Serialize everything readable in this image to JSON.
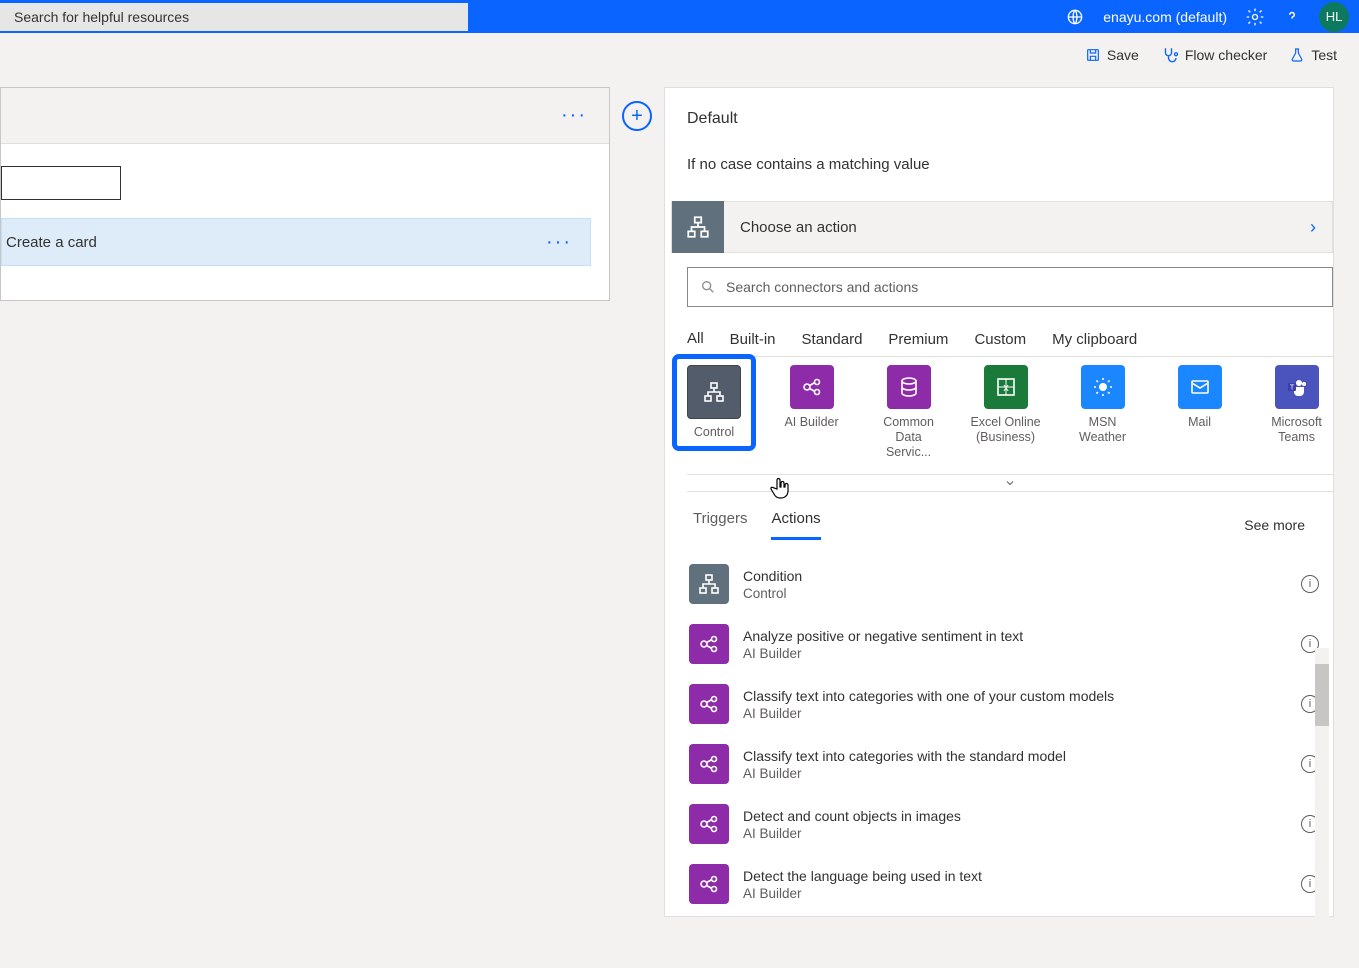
{
  "header": {
    "search_placeholder": "Search for helpful resources",
    "environment": "enayu.com (default)",
    "avatar_initials": "HL"
  },
  "toolbar": {
    "save_label": "Save",
    "flow_checker_label": "Flow checker",
    "test_label": "Test"
  },
  "left_card": {
    "case_label": "Create a card"
  },
  "right_panel": {
    "title": "Default",
    "subtitle": "If no case contains a matching value",
    "choose_label": "Choose an action",
    "search_placeholder": "Search connectors and actions",
    "category_tabs": [
      "All",
      "Built-in",
      "Standard",
      "Premium",
      "Custom",
      "My clipboard"
    ],
    "active_category": "All",
    "connectors": [
      {
        "label": "Control",
        "color": "#525c6b",
        "icon": "control"
      },
      {
        "label": "AI Builder",
        "color": "#8e2ba8",
        "icon": "ai"
      },
      {
        "label": "Common Data Servic...",
        "color": "#8e2ba8",
        "icon": "db"
      },
      {
        "label": "Excel Online (Business)",
        "color": "#1a7a3a",
        "icon": "excel"
      },
      {
        "label": "MSN Weather",
        "color": "#1a86ff",
        "icon": "weather"
      },
      {
        "label": "Mail",
        "color": "#1a86ff",
        "icon": "mail"
      },
      {
        "label": "Microsoft Teams",
        "color": "#4b53bc",
        "icon": "teams"
      }
    ],
    "trigger_tabs": [
      "Triggers",
      "Actions"
    ],
    "active_ta": "Actions",
    "see_more_label": "See more",
    "actions": [
      {
        "title": "Condition",
        "sub": "Control",
        "color": "#61707d",
        "icon": "control"
      },
      {
        "title": "Analyze positive or negative sentiment in text",
        "sub": "AI Builder",
        "color": "#8e2ba8",
        "icon": "ai"
      },
      {
        "title": "Classify text into categories with one of your custom models",
        "sub": "AI Builder",
        "color": "#8e2ba8",
        "icon": "ai"
      },
      {
        "title": "Classify text into categories with the standard model",
        "sub": "AI Builder",
        "color": "#8e2ba8",
        "icon": "ai"
      },
      {
        "title": "Detect and count objects in images",
        "sub": "AI Builder",
        "color": "#8e2ba8",
        "icon": "ai"
      },
      {
        "title": "Detect the language being used in text",
        "sub": "AI Builder",
        "color": "#8e2ba8",
        "icon": "ai"
      }
    ]
  }
}
